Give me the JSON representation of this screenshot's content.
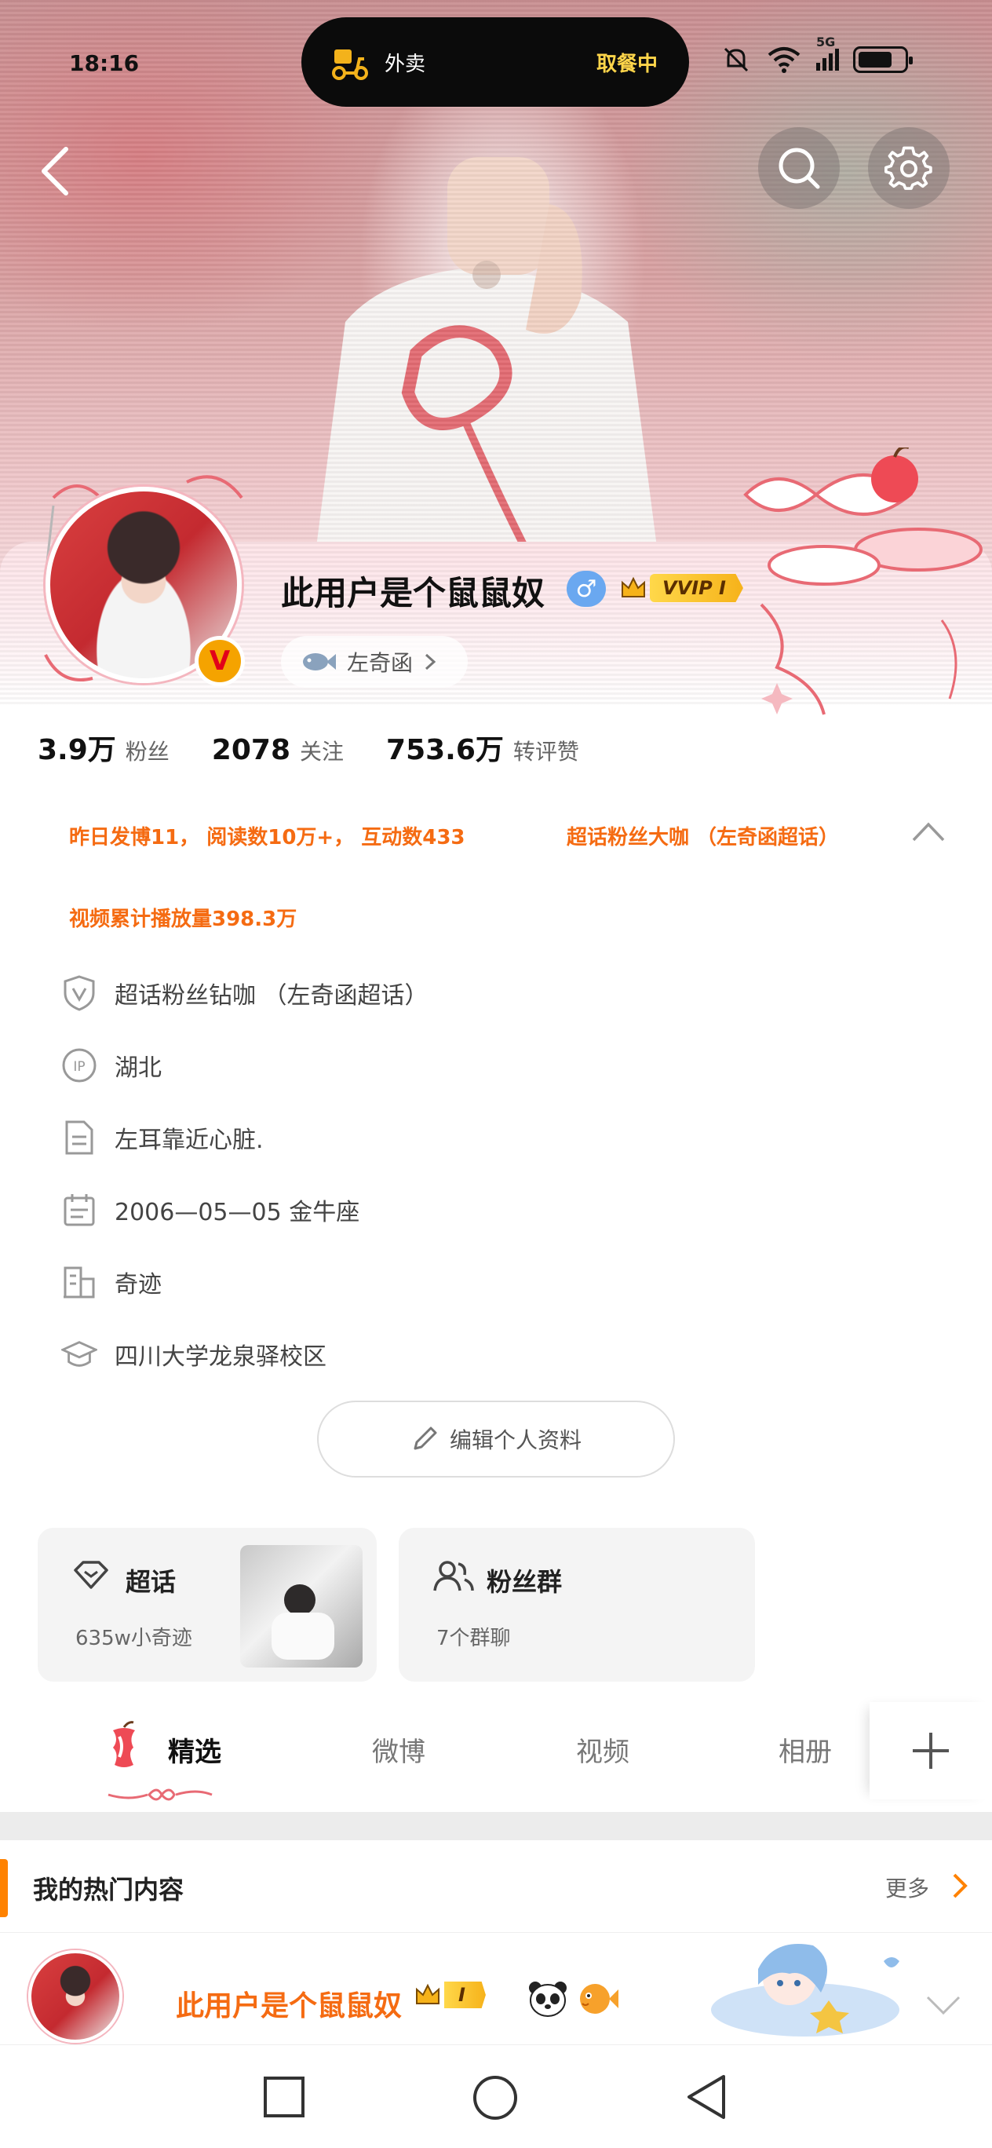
{
  "status_bar": {
    "time": "18:16",
    "island_app": "外卖",
    "island_status": "取餐中",
    "network": "5G"
  },
  "profile": {
    "username": "此用户是个鼠鼠奴",
    "gender_symbol": "♂",
    "vip_label": "VVIP I",
    "verified_badge": "V",
    "friend_chip": "左奇函",
    "stats": [
      {
        "value": "3.9万",
        "label": "粉丝"
      },
      {
        "value": "2078",
        "label": "关注"
      },
      {
        "value": "753.6万",
        "label": "转评赞"
      }
    ],
    "highlights": {
      "line1": "昨日发博11， 阅读数10万+， 互动数433",
      "line1_right": "超话粉丝大咖 （左奇函超话）",
      "line2": "视频累计播放量398.3万"
    },
    "info": [
      {
        "icon": "shield-v-icon",
        "text": "超话粉丝钻咖 （左奇函超话）"
      },
      {
        "icon": "ip-icon",
        "text": "湖北"
      },
      {
        "icon": "document-icon",
        "text": "左耳靠近心脏."
      },
      {
        "icon": "calendar-icon",
        "text": "2006—05—05  金牛座"
      },
      {
        "icon": "company-icon",
        "text": "奇迹"
      },
      {
        "icon": "graduation-cap-icon",
        "text": "四川大学龙泉驿校区"
      }
    ],
    "edit_button": "编辑个人资料"
  },
  "cards": {
    "supertopic": {
      "title": "超话",
      "sub": "635w小奇迹"
    },
    "fangroup": {
      "title": "粉丝群",
      "sub": "7个群聊"
    }
  },
  "tabs": [
    "精选",
    "微博",
    "视频",
    "相册"
  ],
  "hot": {
    "title": "我的热门内容",
    "more": "更多",
    "post_user": "此用户是个鼠鼠奴",
    "post_vip": "I"
  },
  "colors": {
    "accent_orange": "#f56b12",
    "brand_orange": "#ff8200",
    "vip_gold": "#f6b21a"
  }
}
